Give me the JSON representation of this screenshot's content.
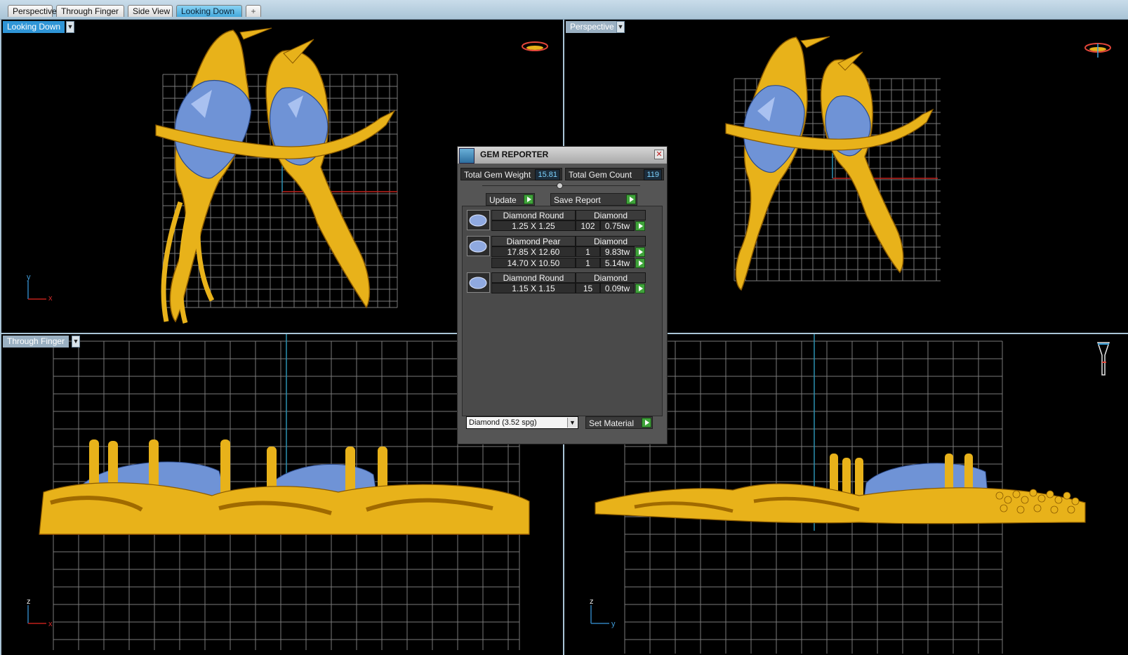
{
  "tabs": [
    {
      "label": "Perspective",
      "active": false
    },
    {
      "label": "Through Finger",
      "active": false
    },
    {
      "label": "Side View",
      "active": false
    },
    {
      "label": "Looking Down",
      "active": true
    }
  ],
  "add_tab_symbol": "+",
  "viewports": {
    "top_left": {
      "label": "Looking Down",
      "axis_v": "y",
      "axis_h": "x"
    },
    "top_right": {
      "label": "Perspective"
    },
    "bottom_left": {
      "label": "Through Finger",
      "axis_v": "z",
      "axis_h": "x"
    },
    "bottom_right": {
      "axis_v": "z",
      "axis_h": "y"
    }
  },
  "dropdown_arrow": "▼",
  "gem_reporter": {
    "title": "GEM REPORTER",
    "close_glyph": "✕",
    "total_weight_label": "Total Gem Weight",
    "total_weight_value": "15.81",
    "total_count_label": "Total Gem Count",
    "total_count_value": "119",
    "update_label": "Update",
    "save_report_label": "Save Report",
    "groups": [
      {
        "shape": "Diamond Round",
        "material": "Diamond",
        "rows": [
          {
            "size": "1.25 X 1.25",
            "count": "102",
            "weight": "0.75tw"
          }
        ]
      },
      {
        "shape": "Diamond Pear",
        "material": "Diamond",
        "rows": [
          {
            "size": "17.85 X 12.60",
            "count": "1",
            "weight": "9.83tw"
          },
          {
            "size": "14.70 X 10.50",
            "count": "1",
            "weight": "5.14tw"
          }
        ]
      },
      {
        "shape": "Diamond Round",
        "material": "Diamond",
        "rows": [
          {
            "size": "1.15 X 1.15",
            "count": "15",
            "weight": "0.09tw"
          }
        ]
      }
    ],
    "material_select_value": "Diamond    (3.52 spg)",
    "set_material_label": "Set Material"
  },
  "colors": {
    "gold": "#e8b21a",
    "gem_blue": "#6f93d6",
    "grid": "#8a8a8a",
    "accent": "#2f95d6"
  }
}
